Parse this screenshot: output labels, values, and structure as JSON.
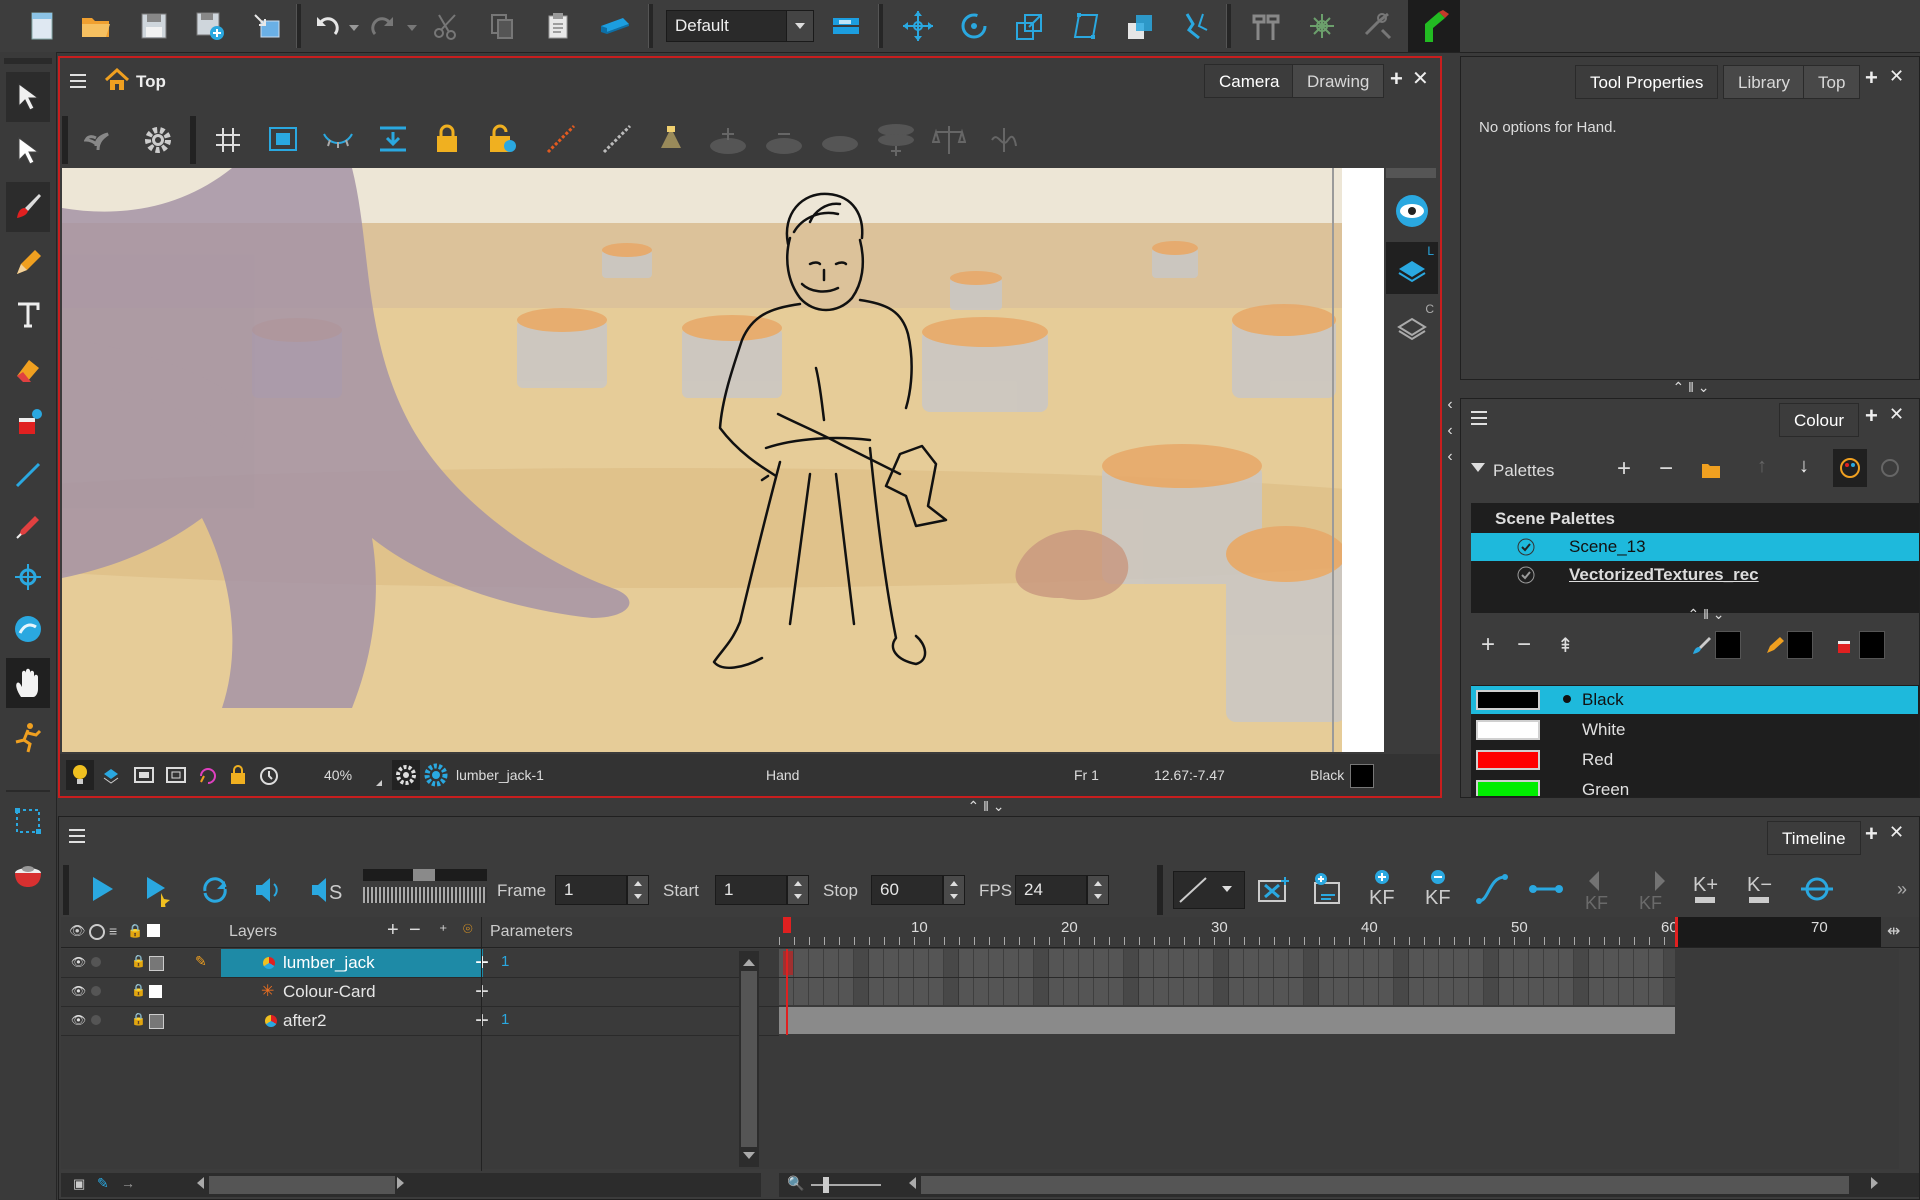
{
  "toolbar": {
    "workspace_value": "Default",
    "icons": [
      "new-icon",
      "open-icon",
      "save-icon",
      "save-as-icon",
      "import-icon",
      "undo-icon",
      "redo-icon",
      "cut-icon",
      "copy-icon",
      "paste-icon",
      "library-icon",
      "ruler-icon",
      "transform-icon",
      "rotate-icon",
      "scale-icon",
      "skew-icon",
      "maintain-size-icon",
      "morph-icon",
      "hammer-icon",
      "reset-icon",
      "tools-icon",
      "ik-icon"
    ]
  },
  "viewport": {
    "title": "Top",
    "tabs": [
      "Camera",
      "Drawing"
    ],
    "status": {
      "zoom": "40%",
      "drawing": "lumber_jack-1",
      "tool": "Hand",
      "frame": "Fr 1",
      "coords": "12.67:-7.47",
      "colour": "Black"
    },
    "side_labels": [
      "L",
      "C"
    ]
  },
  "tool_properties": {
    "tabs": [
      "Tool Properties",
      "Library",
      "Top"
    ],
    "message": "No options for Hand."
  },
  "colour": {
    "tab": "Colour",
    "palettes_label": "Palettes",
    "scene_palettes_header": "Scene Palettes",
    "palettes": [
      {
        "name": "Scene_13",
        "selected": true
      },
      {
        "name": "VectorizedTextures_rec",
        "selected": false
      }
    ],
    "swatches": [
      {
        "name": "Black",
        "color": "#000000",
        "selected": true
      },
      {
        "name": "White",
        "color": "#ffffff",
        "selected": false
      },
      {
        "name": "Red",
        "color": "#ff0000",
        "selected": false
      },
      {
        "name": "Green",
        "color": "#00ee00",
        "selected": false
      }
    ]
  },
  "timeline": {
    "tab": "Timeline",
    "frame_label": "Frame",
    "frame_value": "1",
    "start_label": "Start",
    "start_value": "1",
    "stop_label": "Stop",
    "stop_value": "60",
    "fps_label": "FPS",
    "fps_value": "24",
    "layers_header": "Layers",
    "parameters_header": "Parameters",
    "ruler_ticks": [
      "10",
      "20",
      "30",
      "40",
      "50",
      "60",
      "70"
    ],
    "layers": [
      {
        "name": "lumber_jack",
        "param": "1",
        "selected": true
      },
      {
        "name": "Colour-Card",
        "param": "",
        "selected": false
      },
      {
        "name": "after2",
        "param": "1",
        "selected": false
      }
    ],
    "kf_label": "KF"
  },
  "colors": {
    "accent": "#19b6d8",
    "selection": "#1eb9dc",
    "viewport_border": "#c81e1e",
    "playhead": "#e02020"
  }
}
